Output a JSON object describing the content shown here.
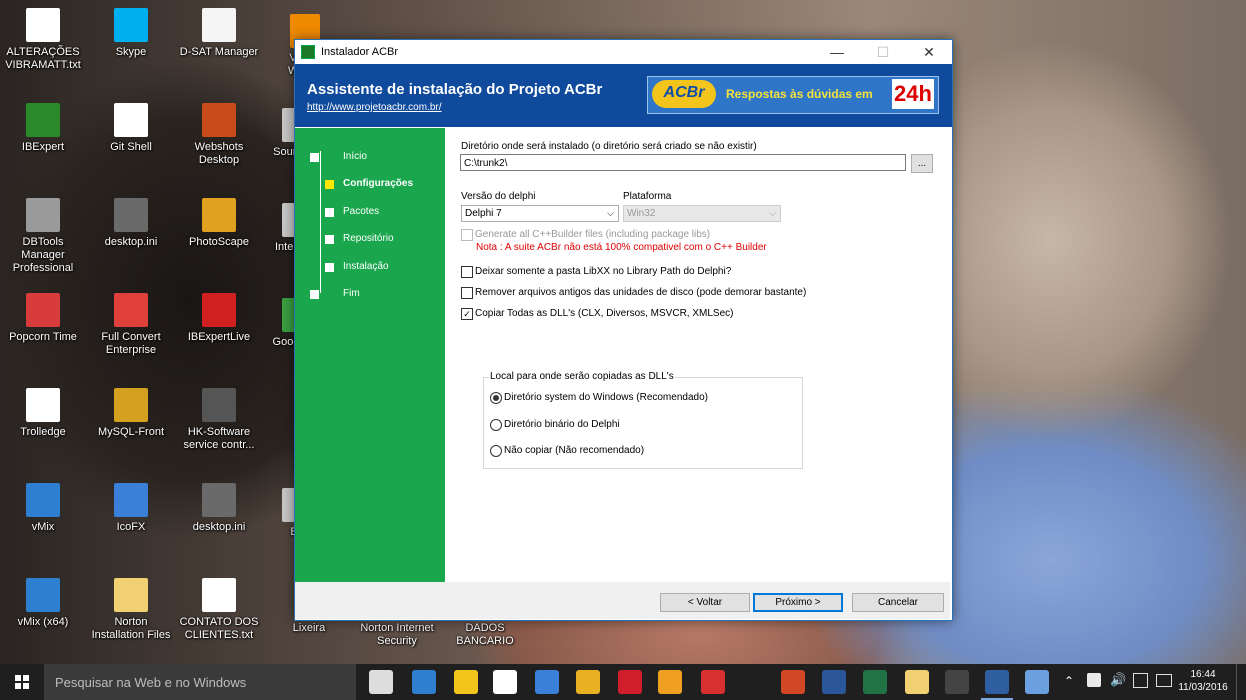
{
  "desktop": {
    "icons": [
      {
        "label": "ALTERAÇÕES VIBRAMATT.txt",
        "color": "#ffffff"
      },
      {
        "label": "Skype",
        "color": "#00aff0"
      },
      {
        "label": "D-SAT Manager",
        "color": "#f5f5f5"
      },
      {
        "label": "IBExpert",
        "color": "#2a8a2a"
      },
      {
        "label": "Git Shell",
        "color": "#ffffff"
      },
      {
        "label": "Webshots Desktop",
        "color": "#c84c1a"
      },
      {
        "label": "DBTools Manager Professional",
        "color": "#9a9a9a"
      },
      {
        "label": "desktop.ini",
        "color": "#6a6a6a"
      },
      {
        "label": "PhotoScape",
        "color": "#e0a020"
      },
      {
        "label": "Popcorn Time",
        "color": "#d83b3b"
      },
      {
        "label": "Full Convert Enterprise",
        "color": "#e0403c"
      },
      {
        "label": "IBExpertLive",
        "color": "#d02020"
      },
      {
        "label": "Trolledge",
        "color": "#ffffff"
      },
      {
        "label": "MySQL-Front",
        "color": "#d4a020"
      },
      {
        "label": "HK-Software service contr...",
        "color": "#555555"
      },
      {
        "label": "vMix",
        "color": "#2f7fd0"
      },
      {
        "label": "IcoFX",
        "color": "#3a80d8"
      },
      {
        "label": "desktop.ini",
        "color": "#6a6a6a"
      },
      {
        "label": "vMix (x64)",
        "color": "#2f7fd0"
      },
      {
        "label": "Norton Installation Files",
        "color": "#f0d070"
      },
      {
        "label": "CONTATO DOS CLIENTES.txt",
        "color": "#ffffff"
      },
      {
        "label": "Lixeira",
        "color": "#dddddd"
      },
      {
        "label": "Norton Internet Security",
        "color": "#f2c200"
      },
      {
        "label": "DADOS BANCARIO",
        "color": "#ffffff"
      }
    ],
    "partial_labels": [
      "V Wo",
      "Soun",
      "Inter",
      "Goog",
      "B"
    ]
  },
  "window": {
    "title": "Instalador ACBr",
    "minimize": "—",
    "maximize": "☐",
    "close": "✕",
    "banner": {
      "title": "Assistente de instalação do Projeto ACBr",
      "link": "http://www.projetoacbr.com.br/",
      "ad_logo": "ACBr",
      "ad_text": "Respostas às dúvidas em",
      "ad_number": "24h"
    },
    "steps": [
      {
        "label": "Início",
        "current": false
      },
      {
        "label": "Configurações",
        "current": true
      },
      {
        "label": "Pacotes",
        "current": false
      },
      {
        "label": "Repositório",
        "current": false
      },
      {
        "label": "Instalação",
        "current": false
      },
      {
        "label": "Fim",
        "current": false
      }
    ],
    "form": {
      "dir_label": "Diretório onde será instalado (o diretório será criado se não existir)",
      "dir_value": "C:\\trunk2\\",
      "browse_label": "...",
      "delphi_label": "Versão do delphi",
      "delphi_value": "Delphi 7",
      "platform_label": "Plataforma",
      "platform_value": "Win32",
      "cpp_label": "Generate all C++Builder files (including package libs)",
      "cpp_checked": false,
      "cpp_note": "Nota : A suite ACBr não está 100% compativel com o C++ Builder",
      "libxx_label": "Deixar somente a pasta LibXX no Library Path do Delphi?",
      "libxx_checked": false,
      "remove_label": "Remover arquivos antigos das unidades de disco (pode demorar bastante)",
      "remove_checked": false,
      "copy_dll_label": "Copiar Todas as DLL's (CLX, Diversos, MSVCR, XMLSec)",
      "copy_dll_checked": true,
      "group_title": "Local para onde serão copiadas as DLL's",
      "radios": [
        {
          "label": "Diretório system do Windows (Recomendado)",
          "selected": true
        },
        {
          "label": "Diretório binário do Delphi",
          "selected": false
        },
        {
          "label": "Não copiar (Não recomendado)",
          "selected": false
        }
      ]
    },
    "buttons": {
      "back": "< Voltar",
      "next": "Próximo >",
      "cancel": "Cancelar"
    }
  },
  "taskbar": {
    "search_placeholder": "Pesquisar na Web e no Windows",
    "time": "16:44",
    "date": "11/03/2016",
    "apps": [
      "task-view",
      "edge",
      "file-explorer",
      "store",
      "app-blue",
      "chrome",
      "opera",
      "media",
      "app-red",
      "powerpoint",
      "word",
      "excel",
      "files",
      "skype",
      "cmd",
      "installer",
      "app-misc"
    ],
    "accent": "#0078d7"
  },
  "colors": {
    "sidebar": "#1aa64d",
    "banner": "#0f4a9c",
    "note_red": "#e00000",
    "current_step": "#ffe800"
  }
}
